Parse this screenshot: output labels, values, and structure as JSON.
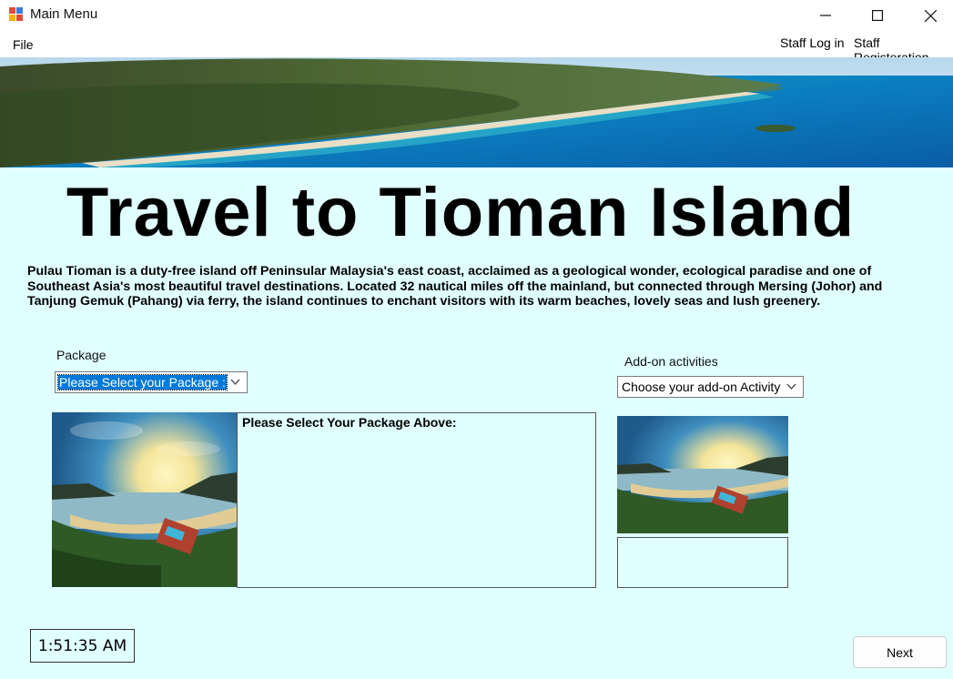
{
  "window": {
    "title": "Main Menu",
    "icons": [
      "app-icon",
      "minimize-icon",
      "maximize-icon",
      "close-icon"
    ]
  },
  "menu": {
    "file": "File",
    "staff_login": "Staff Log in",
    "staff_registration": "Staff Registeration"
  },
  "heading": "Travel to Tioman Island",
  "description": "Pulau Tioman is a duty-free island off Peninsular Malaysia's east coast, acclaimed as a geological wonder, ecological paradise and one of Southeast Asia's most beautiful travel destinations. Located 32 nautical miles off the mainland, but connected through Mersing (Johor) and Tanjung Gemuk (Pahang) via ferry, the island continues to enchant visitors with its warm beaches, lovely seas and lush greenery.",
  "package": {
    "label": "Package",
    "select_value": "Please Select your Package :",
    "details_text": "Please Select Your Package Above:"
  },
  "addon": {
    "label": "Add-on activities",
    "select_value": "Choose your add-on Activity"
  },
  "clock": "1:51:35 AM",
  "next_label": "Next",
  "colors": {
    "background": "#e0ffff",
    "selection": "#0078d7"
  }
}
